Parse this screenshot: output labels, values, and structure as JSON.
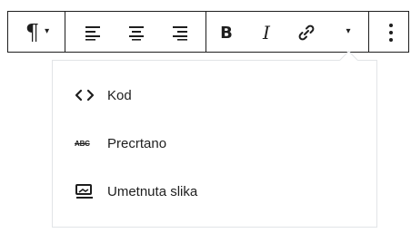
{
  "toolbar": {
    "paragraph_icon": "¶",
    "caret_icon": "▾",
    "bold_label": "B",
    "italic_label": "I",
    "icons": [
      "paragraph-icon",
      "align-left-icon",
      "align-center-icon",
      "align-right-icon",
      "bold-icon",
      "italic-icon",
      "link-icon",
      "more-rich-text-icon",
      "more-options-icon"
    ]
  },
  "dropdown": {
    "items": [
      {
        "label": "Kod",
        "icon": "code-icon"
      },
      {
        "label": "Precrtano",
        "icon_text": "ABC",
        "icon": "strikethrough-icon"
      },
      {
        "label": "Umetnuta slika",
        "icon": "inline-image-icon"
      }
    ]
  }
}
